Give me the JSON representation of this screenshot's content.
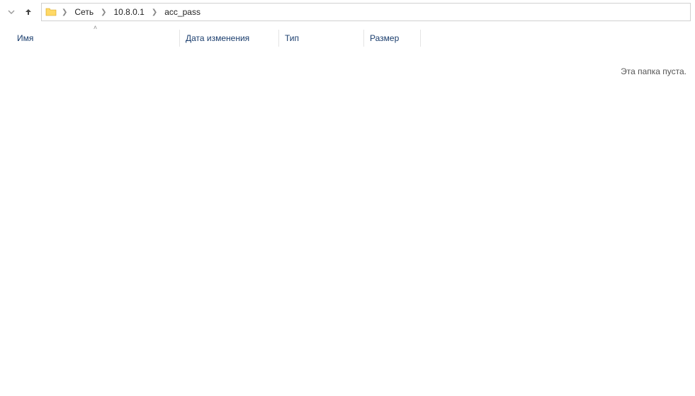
{
  "breadcrumb": {
    "items": [
      {
        "label": "Сеть"
      },
      {
        "label": "10.8.0.1"
      },
      {
        "label": "acc_pass"
      }
    ]
  },
  "columns": {
    "name": "Имя",
    "date": "Дата изменения",
    "type": "Тип",
    "size": "Размер"
  },
  "content": {
    "empty_message": "Эта папка пуста."
  }
}
